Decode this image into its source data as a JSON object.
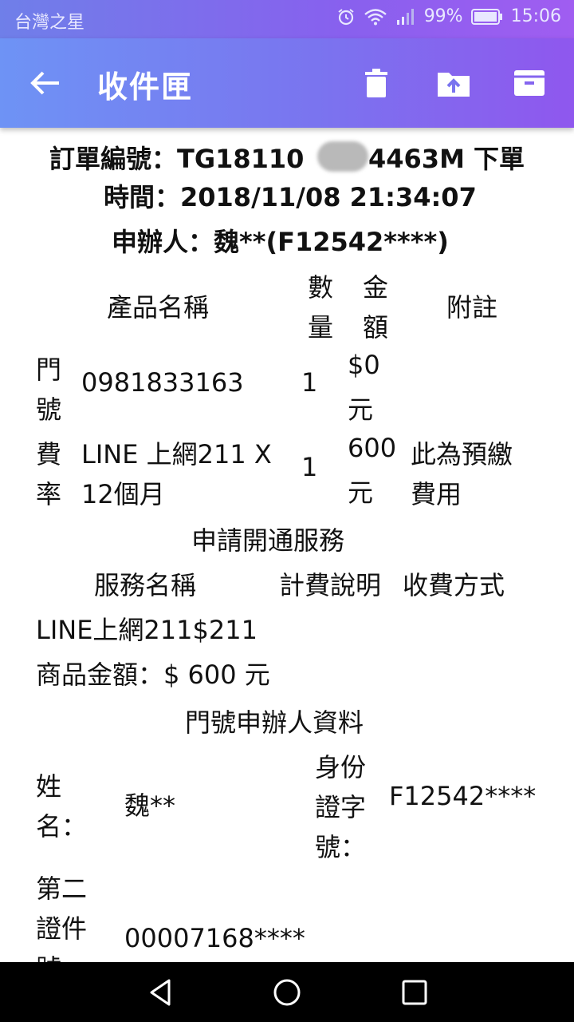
{
  "status_bar": {
    "carrier": "台灣之星",
    "battery": "99%",
    "time": "15:06",
    "icons": [
      "alarm-icon",
      "wifi-icon",
      "signal-icon",
      "battery-icon"
    ]
  },
  "app_bar": {
    "title": "收件匣",
    "actions": [
      "back-arrow-icon",
      "delete-icon",
      "move-to-folder-icon",
      "archive-icon"
    ]
  },
  "email": {
    "order_line1": "訂單編號：TG18110",
    "order_line1_end": "4463M 下單",
    "order_line2": "時間：2018/11/08 21:34:07",
    "applicant_line": "申辦人：魏**(F12542****)",
    "product_table": {
      "headers": {
        "name": "產品名稱",
        "qty_top": "數",
        "qty_bottom": "量",
        "amount_top": "金",
        "amount_bottom": "額",
        "note": "附註"
      },
      "rows": [
        {
          "label_top": "門",
          "label_bottom": "號",
          "name": "0981833163",
          "qty": "1",
          "amount_top": "$0",
          "amount_bottom": "元",
          "note_top": "",
          "note_bottom": ""
        },
        {
          "label_top": "費",
          "label_bottom": "率",
          "name_top": "LINE 上網211 X",
          "name_bottom": "12個月",
          "qty": "1",
          "amount_top": "600",
          "amount_bottom": "元",
          "note_top": "此為預繳",
          "note_bottom": "費用"
        }
      ]
    },
    "service_section_title": "申請開通服務",
    "service_headers": {
      "name": "服務名稱",
      "billing": "計費說明",
      "payment": "收費方式"
    },
    "service_row": "LINE上網211$211",
    "product_amount": "商品金額：$ 600 元",
    "applicant_section_title": "門號申辦人資料",
    "applicant_info": {
      "name_label_top": "姓",
      "name_label_bottom": "名：",
      "name_value": "魏**",
      "id_label_1": "身份",
      "id_label_2": "證字",
      "id_label_3": "號：",
      "id_value": "F12542****",
      "second_id_label_1": "第二",
      "second_id_label_2": "證件",
      "second_id_label_3": "號",
      "second_id_value": "00007168****"
    }
  },
  "colors": {
    "appbar_start": "#6e93f5",
    "appbar_end": "#8f57ee",
    "navbar": "#000000"
  }
}
